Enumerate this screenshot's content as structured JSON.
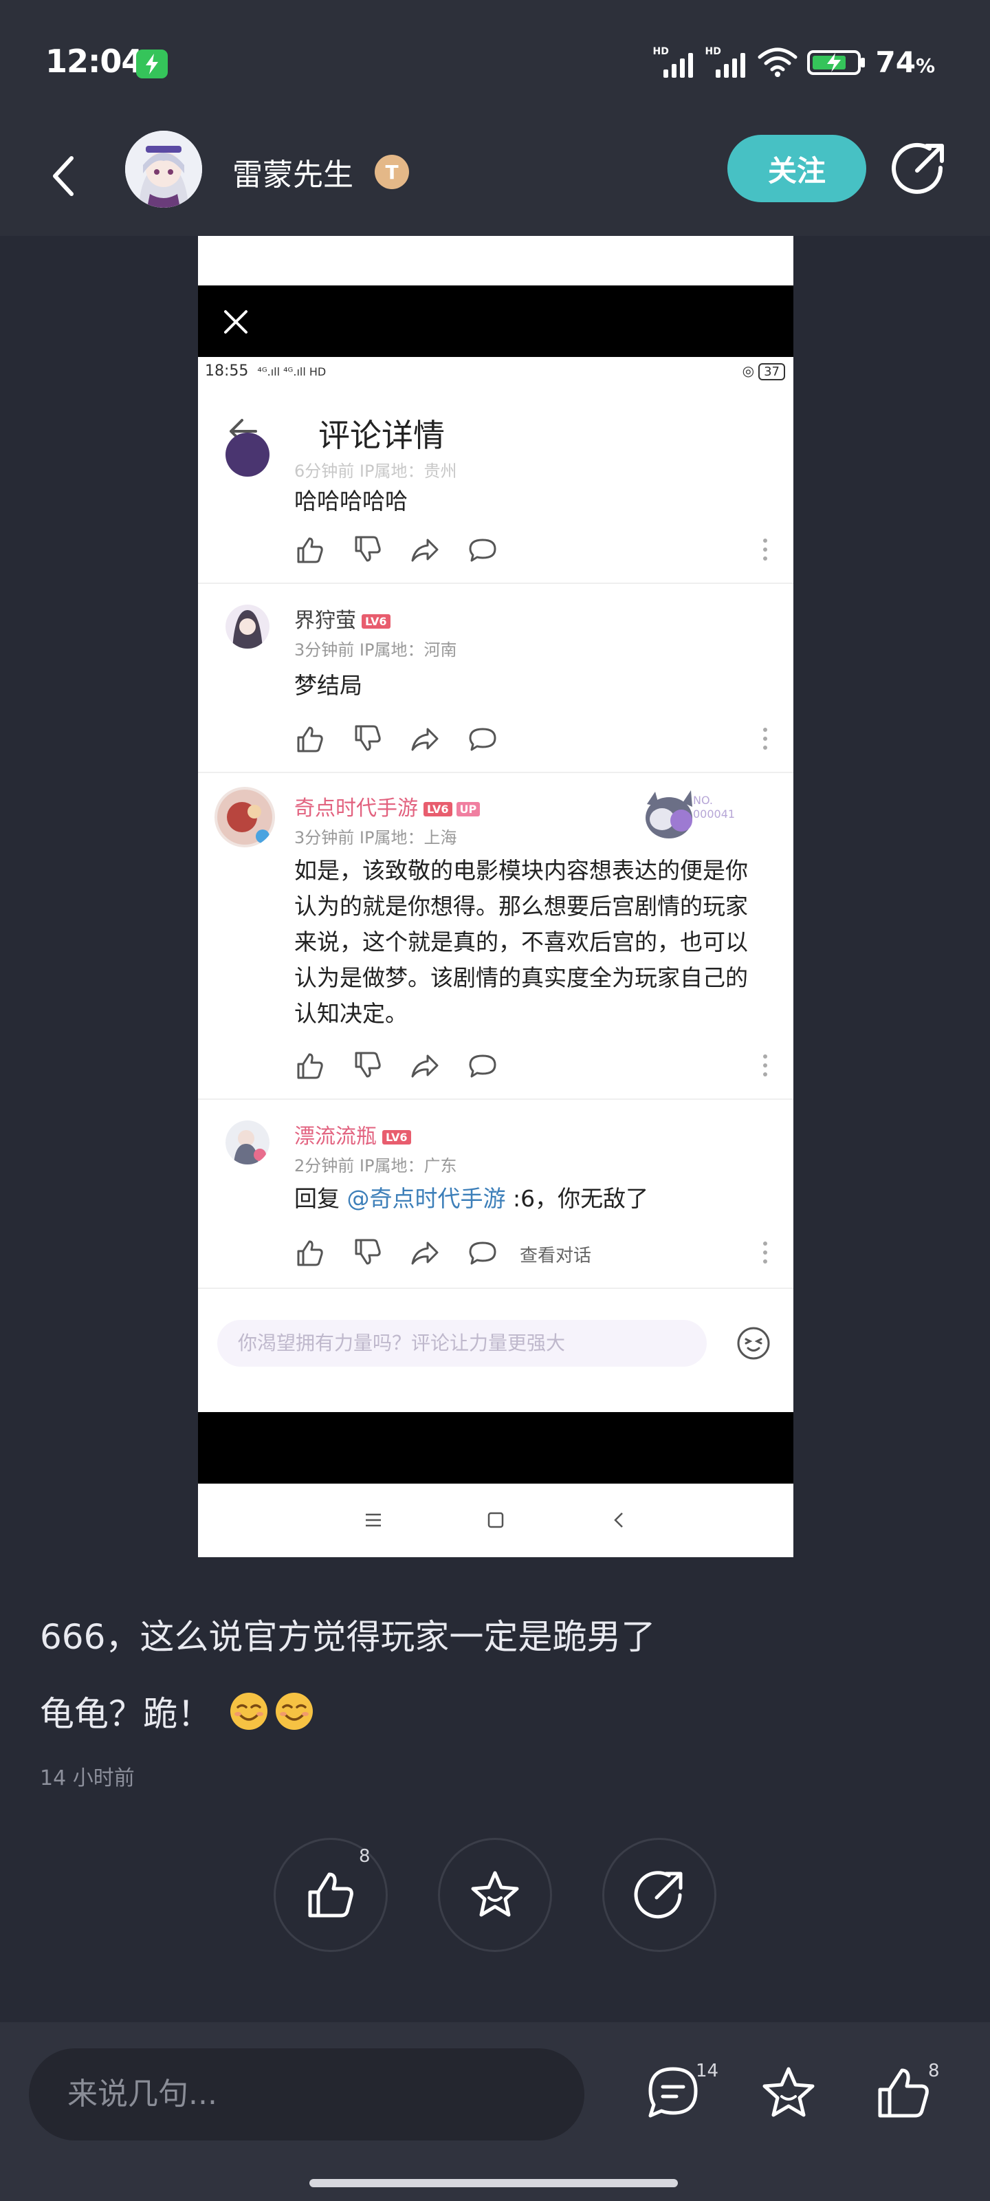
{
  "status_bar": {
    "time": "12:04",
    "signal_1_label": "HD",
    "signal_2_label": "HD",
    "battery_value": "74",
    "battery_unit": "%"
  },
  "header": {
    "author_name": "雷蒙先生",
    "author_badge": "T",
    "follow_label": "关注"
  },
  "screenshot": {
    "status_time": "18:55",
    "status_icons": "⁴ᴳ.ıll ⁴ᴳ.ıll HD",
    "battery": "37",
    "title": "评论详情",
    "comments": [
      {
        "name": "",
        "meta": "6分钟前  IP属地：贵州",
        "text": "哈哈哈哈哈"
      },
      {
        "name": "界狩萤",
        "level": "LV6",
        "meta": "3分钟前  IP属地：河南",
        "text": "梦结局"
      },
      {
        "name": "奇点时代手游",
        "level": "LV6",
        "up": "UP",
        "meta": "3分钟前  IP属地：上海",
        "fan_label": "NO.",
        "fan_number": "000041",
        "text": "如是，该致敬的电影模块内容想表达的便是你认为的就是你想得。那么想要后宫剧情的玩家来说，这个就是真的，不喜欢后宫的，也可以认为是做梦。该剧情的真实度全为玩家自己的认知决定。"
      },
      {
        "name": "漂流流瓶",
        "level": "LV6",
        "meta": "2分钟前  IP属地：广东",
        "reply_prefix": "回复 ",
        "reply_mention": "@奇点时代手游",
        "reply_text": " :6，你无敌了",
        "view_dialog": "查看对话"
      }
    ],
    "input_placeholder": "你渴望拥有力量吗？评论让力量更强大"
  },
  "post": {
    "line1": "666，这么说官方觉得玩家一定是跪男了",
    "line2": "龟龟？跪！",
    "emoji_name": "smirk-emoji",
    "time": "14 小时前"
  },
  "actions": {
    "like_count": "8"
  },
  "bottom_bar": {
    "input_placeholder": "来说几句...",
    "comment_count": "14",
    "like_count": "8"
  },
  "colors": {
    "background": "#272a35",
    "header": "#2d303a",
    "follow_button": "#47c1c4",
    "level_badge": "#e85d6e",
    "mention": "#3d7fb9"
  }
}
